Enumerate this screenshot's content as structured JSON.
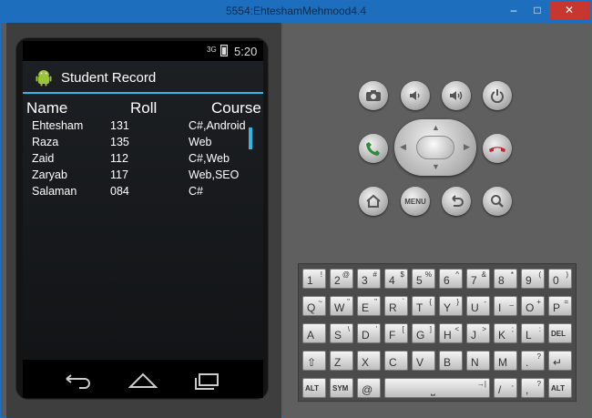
{
  "window": {
    "title": "5554:EhteshamMehmood4.4",
    "minimize": "–",
    "maximize": "□",
    "close": "✕"
  },
  "status": {
    "signal": "3G",
    "time": "5:20"
  },
  "app": {
    "title": "Student Record",
    "icon": "android-logo"
  },
  "table": {
    "headers": {
      "name": "Name",
      "roll": "Roll",
      "course": "Course"
    },
    "rows": [
      {
        "name": "Ehtesham",
        "roll": "131",
        "course": "C#,Android"
      },
      {
        "name": "Raza",
        "roll": "135",
        "course": "Web"
      },
      {
        "name": "Zaid",
        "roll": "112",
        "course": "C#,Web"
      },
      {
        "name": "Zaryab",
        "roll": "117",
        "course": "Web,SEO"
      },
      {
        "name": "Salaman",
        "roll": "084",
        "course": "C#"
      }
    ]
  },
  "navbar": {
    "icons": [
      "back-icon",
      "home-icon",
      "recent-apps-icon"
    ]
  },
  "controls": {
    "icons": [
      "camera-icon",
      "volume-down-icon",
      "volume-up-icon",
      "power-icon",
      "call-icon",
      "end-call-icon",
      "home-icon",
      "back-icon",
      "search-icon"
    ],
    "menu_label": "MENU"
  },
  "keyboard": {
    "row1": [
      {
        "m": "1",
        "s": "!"
      },
      {
        "m": "2",
        "s": "@"
      },
      {
        "m": "3",
        "s": "#"
      },
      {
        "m": "4",
        "s": "$"
      },
      {
        "m": "5",
        "s": "%"
      },
      {
        "m": "6",
        "s": "^"
      },
      {
        "m": "7",
        "s": "&"
      },
      {
        "m": "8",
        "s": "*"
      },
      {
        "m": "9",
        "s": "("
      },
      {
        "m": "0",
        "s": ")"
      }
    ],
    "row2": [
      {
        "m": "Q",
        "s": "~"
      },
      {
        "m": "W",
        "s": "\""
      },
      {
        "m": "E",
        "s": "\""
      },
      {
        "m": "R",
        "s": "`"
      },
      {
        "m": "T",
        "s": "{"
      },
      {
        "m": "Y",
        "s": "}"
      },
      {
        "m": "U",
        "s": "-"
      },
      {
        "m": "I",
        "s": "_"
      },
      {
        "m": "O",
        "s": "+"
      },
      {
        "m": "P",
        "s": "="
      }
    ],
    "row3": [
      {
        "m": "A",
        "s": ""
      },
      {
        "m": "S",
        "s": "\\"
      },
      {
        "m": "D",
        "s": "'"
      },
      {
        "m": "F",
        "s": "["
      },
      {
        "m": "G",
        "s": "]"
      },
      {
        "m": "H",
        "s": "<"
      },
      {
        "m": "J",
        "s": ">"
      },
      {
        "m": "K",
        "s": ";"
      },
      {
        "m": "L",
        "s": ":"
      },
      {
        "m": "DEL",
        "s": ""
      }
    ],
    "row4": [
      {
        "m": "⇧",
        "s": ""
      },
      {
        "m": "Z",
        "s": ""
      },
      {
        "m": "X",
        "s": ""
      },
      {
        "m": "C",
        "s": ""
      },
      {
        "m": "V",
        "s": ""
      },
      {
        "m": "B",
        "s": ""
      },
      {
        "m": "N",
        "s": ""
      },
      {
        "m": "M",
        "s": ""
      },
      {
        "m": ".",
        "s": "?"
      },
      {
        "m": "↵",
        "s": ""
      }
    ],
    "row5": [
      {
        "m": "ALT",
        "s": ""
      },
      {
        "m": "SYM",
        "s": ""
      },
      {
        "m": "@",
        "s": ""
      },
      {
        "m": "⎵",
        "s": "→|"
      },
      {
        "m": "/",
        "s": ","
      },
      {
        "m": ",",
        "s": "?"
      },
      {
        "m": "ALT",
        "s": ""
      }
    ]
  }
}
